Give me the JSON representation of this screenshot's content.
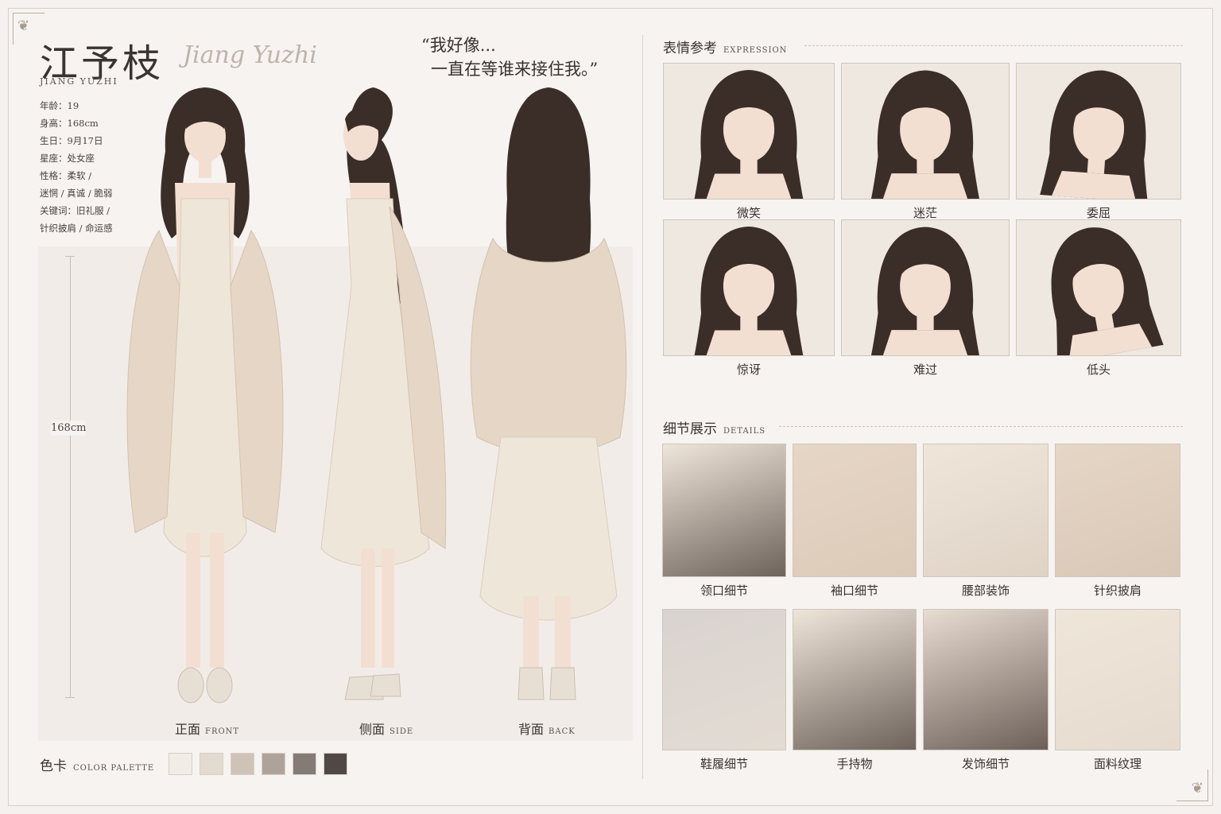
{
  "character": {
    "name_cn": "江予枝",
    "name_script": "Jiang Yuzhi",
    "name_en": "JIANG YUZHI",
    "quote_line1": "“我好像...",
    "quote_line2": "一直在等谁来接住我。”"
  },
  "info": [
    "年龄：19",
    "身高：168cm",
    "生日：9月17日",
    "星座：处女座",
    "性格：柔软 /",
    "迷惘 / 真诚 / 脆弱",
    "关键词：旧礼服 /",
    "针织披肩 / 命运感"
  ],
  "ruler": {
    "label": "168cm"
  },
  "views": [
    {
      "cn": "正面",
      "en": "FRONT"
    },
    {
      "cn": "侧面",
      "en": "SIDE"
    },
    {
      "cn": "背面",
      "en": "BACK"
    }
  ],
  "palette": {
    "title_cn": "色卡",
    "title_en": "COLOR PALETTE",
    "colors": [
      "#f1ece5",
      "#e3dad0",
      "#cfc3b8",
      "#aea39b",
      "#857b76",
      "#4f4845"
    ]
  },
  "expression": {
    "title_cn": "表情参考",
    "title_en": "EXPRESSION",
    "items": [
      "微笑",
      "迷茫",
      "委屈",
      "惊讶",
      "难过",
      "低头"
    ]
  },
  "details": {
    "title_cn": "细节展示",
    "title_en": "DETAILS",
    "items": [
      "领口细节",
      "袖口细节",
      "腰部装饰",
      "针织披肩",
      "鞋履细节",
      "手持物",
      "发饰细节",
      "面料纹理"
    ]
  },
  "colors": {
    "hair": "#3b2e28",
    "skin": "#f3dfd2",
    "dress": "#efe6da",
    "shawl": "#e6d6c6",
    "shoe": "#e8dfd4",
    "background": "#f6f3f0"
  }
}
